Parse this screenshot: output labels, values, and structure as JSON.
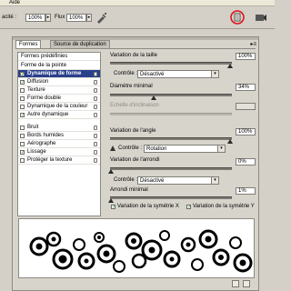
{
  "menubar": {
    "item": "Aide"
  },
  "options": {
    "opacity_label": "acité :",
    "opacity_value": "100%",
    "flow_label": "Flux :",
    "flow_value": "100%"
  },
  "panel": {
    "tabs": [
      "Formes",
      "Source de duplication"
    ],
    "menu_glyph": "▸≡",
    "list": [
      {
        "label": "Formes prédéfinies",
        "type": "header"
      },
      {
        "label": "Forme de la pointe",
        "type": "header"
      },
      {
        "label": "Dynamique de forme",
        "checked": true,
        "selected": true
      },
      {
        "label": "Diffusion",
        "checked": true
      },
      {
        "label": "Texture",
        "checked": false
      },
      {
        "label": "Forme double",
        "checked": false
      },
      {
        "label": "Dynamique de la couleur",
        "checked": false
      },
      {
        "label": "Autre dynamique",
        "checked": true
      },
      {
        "label": "Bruit",
        "checked": false
      },
      {
        "label": "Bords humides",
        "checked": false
      },
      {
        "label": "Aérographe",
        "checked": false
      },
      {
        "label": "Lissage",
        "checked": true
      },
      {
        "label": "Protéger la texture",
        "checked": false
      }
    ],
    "settings": {
      "size_jitter_label": "Variation de la taille",
      "size_jitter_value": "100%",
      "control1_label": "Contrôle :",
      "control1_value": "Désactivé",
      "min_diameter_label": "Diamètre minimal",
      "min_diameter_value": "34%",
      "tilt_scale_label": "Echelle d'inclinaison",
      "angle_jitter_label": "Variation de l'angle",
      "angle_jitter_value": "100%",
      "control2_label": "Contrôle :",
      "control2_value": "Rotation",
      "roundness_jitter_label": "Variation de l'arrondi",
      "roundness_jitter_value": "0%",
      "control3_label": "Contrôle :",
      "control3_value": "Désactivé",
      "min_roundness_label": "Arrondi minimal",
      "min_roundness_value": "1%",
      "flip_x_label": "Variation de la symétrie X",
      "flip_y_label": "Variation de la symétrie Y",
      "flip_x_checked": true,
      "flip_y_checked": true
    }
  },
  "colors": {
    "selection": "#2a3f8c",
    "highlight_circle": "#e0121a"
  }
}
